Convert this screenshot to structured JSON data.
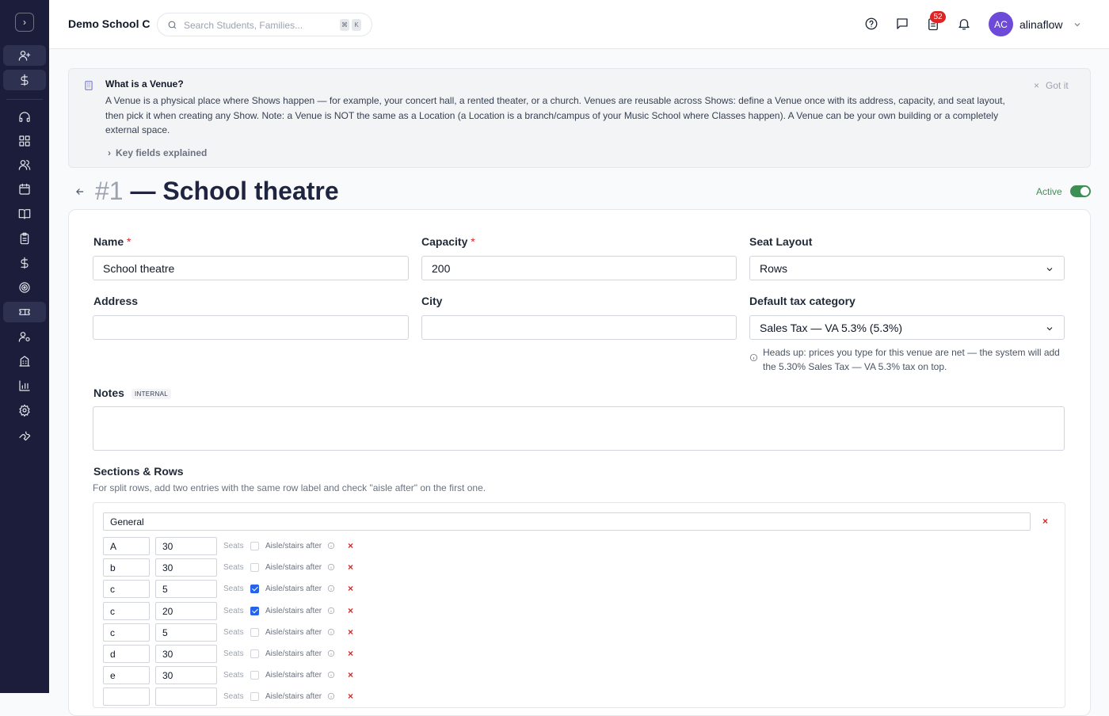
{
  "topbar": {
    "school_name": "Demo School C",
    "search_placeholder": "Search Students, Families...",
    "kbd_1": "⌘",
    "kbd_2": "K",
    "notification_count": "52",
    "avatar_initials": "AC",
    "username": "alinaflow"
  },
  "info": {
    "title": "What is a Venue?",
    "text": "A Venue is a physical place where Shows happen — for example, your concert hall, a rented theater, or a church. Venues are reusable across Shows: define a Venue once with its address, capacity, and seat layout, then pick it when creating any Show. Note: a Venue is NOT the same as a Location (a Location is a branch/campus of your Music School where Classes happen). A Venue can be your own building or a completely external space.",
    "dismiss": "Got it",
    "key_fields": "Key fields explained"
  },
  "header": {
    "number": "#1",
    "title": "— School theatre",
    "status": "Active"
  },
  "form": {
    "name_label": "Name",
    "name_value": "School theatre",
    "capacity_label": "Capacity",
    "capacity_value": "200",
    "seat_layout_label": "Seat Layout",
    "seat_layout_value": "Rows",
    "address_label": "Address",
    "address_value": "",
    "city_label": "City",
    "city_value": "",
    "tax_label": "Default tax category",
    "tax_value": "Sales Tax — VA 5.3% (5.3%)",
    "tax_hint": "Heads up: prices you type for this venue are net — the system will add the 5.30% Sales Tax — VA 5.3% tax on top.",
    "notes_label": "Notes",
    "notes_badge": "INTERNAL",
    "required_mark": "*"
  },
  "sections": {
    "title": "Sections & Rows",
    "subtitle": "For split rows, add two entries with the same row label and check \"aisle after\" on the first one.",
    "section_name": "General",
    "seats_label": "Seats",
    "aisle_label": "Aisle/stairs after",
    "remove_glyph": "×",
    "rows": [
      {
        "label": "A",
        "seats": "30",
        "aisle": false
      },
      {
        "label": "b",
        "seats": "30",
        "aisle": false
      },
      {
        "label": "c",
        "seats": "5",
        "aisle": true
      },
      {
        "label": "c",
        "seats": "20",
        "aisle": true
      },
      {
        "label": "c",
        "seats": "5",
        "aisle": false
      },
      {
        "label": "d",
        "seats": "30",
        "aisle": false
      },
      {
        "label": "e",
        "seats": "30",
        "aisle": false
      },
      {
        "label": "",
        "seats": "",
        "aisle": false
      }
    ]
  },
  "colors": {
    "sidebar_bg": "#1b1d3a",
    "accent_green": "#3f8e55",
    "danger": "#dc2626",
    "avatar_bg": "#6d4bd8",
    "checkbox_blue": "#2563eb"
  },
  "icons": {
    "sidebar": [
      "user-plus-icon",
      "dollar-icon",
      "headset-icon",
      "grid-icon",
      "users-icon",
      "calendar-icon",
      "book-icon",
      "clipboard-icon",
      "dollar-icon",
      "target-icon",
      "ticket-icon",
      "user-gear-icon",
      "building-icon",
      "chart-icon",
      "settings-icon",
      "wrench-icon"
    ]
  }
}
